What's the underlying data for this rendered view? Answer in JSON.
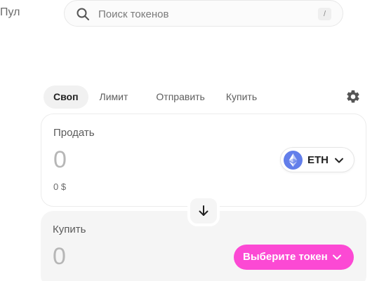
{
  "nav": {
    "pool_label": "Пул"
  },
  "search": {
    "placeholder": "Поиск токенов",
    "shortcut": "/"
  },
  "tabs": [
    {
      "label": "Своп",
      "active": true
    },
    {
      "label": "Лимит",
      "active": false
    },
    {
      "label": "Отправить",
      "active": false
    },
    {
      "label": "Купить",
      "active": false
    }
  ],
  "sell": {
    "label": "Продать",
    "amount": "0",
    "usd_value": "0 $",
    "token": {
      "symbol": "ETH",
      "icon": "eth-icon"
    }
  },
  "buy": {
    "label": "Купить",
    "amount": "0",
    "select_token_label": "Выберите токен"
  },
  "colors": {
    "accent_pink": "#fc49d4",
    "eth_blue": "#627eea",
    "muted_text": "#b6b6b6",
    "panel_bg": "#f5f5f5"
  },
  "icons": [
    "search-icon",
    "settings-gear-icon",
    "eth-icon",
    "chevron-down-icon",
    "arrow-down-icon"
  ]
}
